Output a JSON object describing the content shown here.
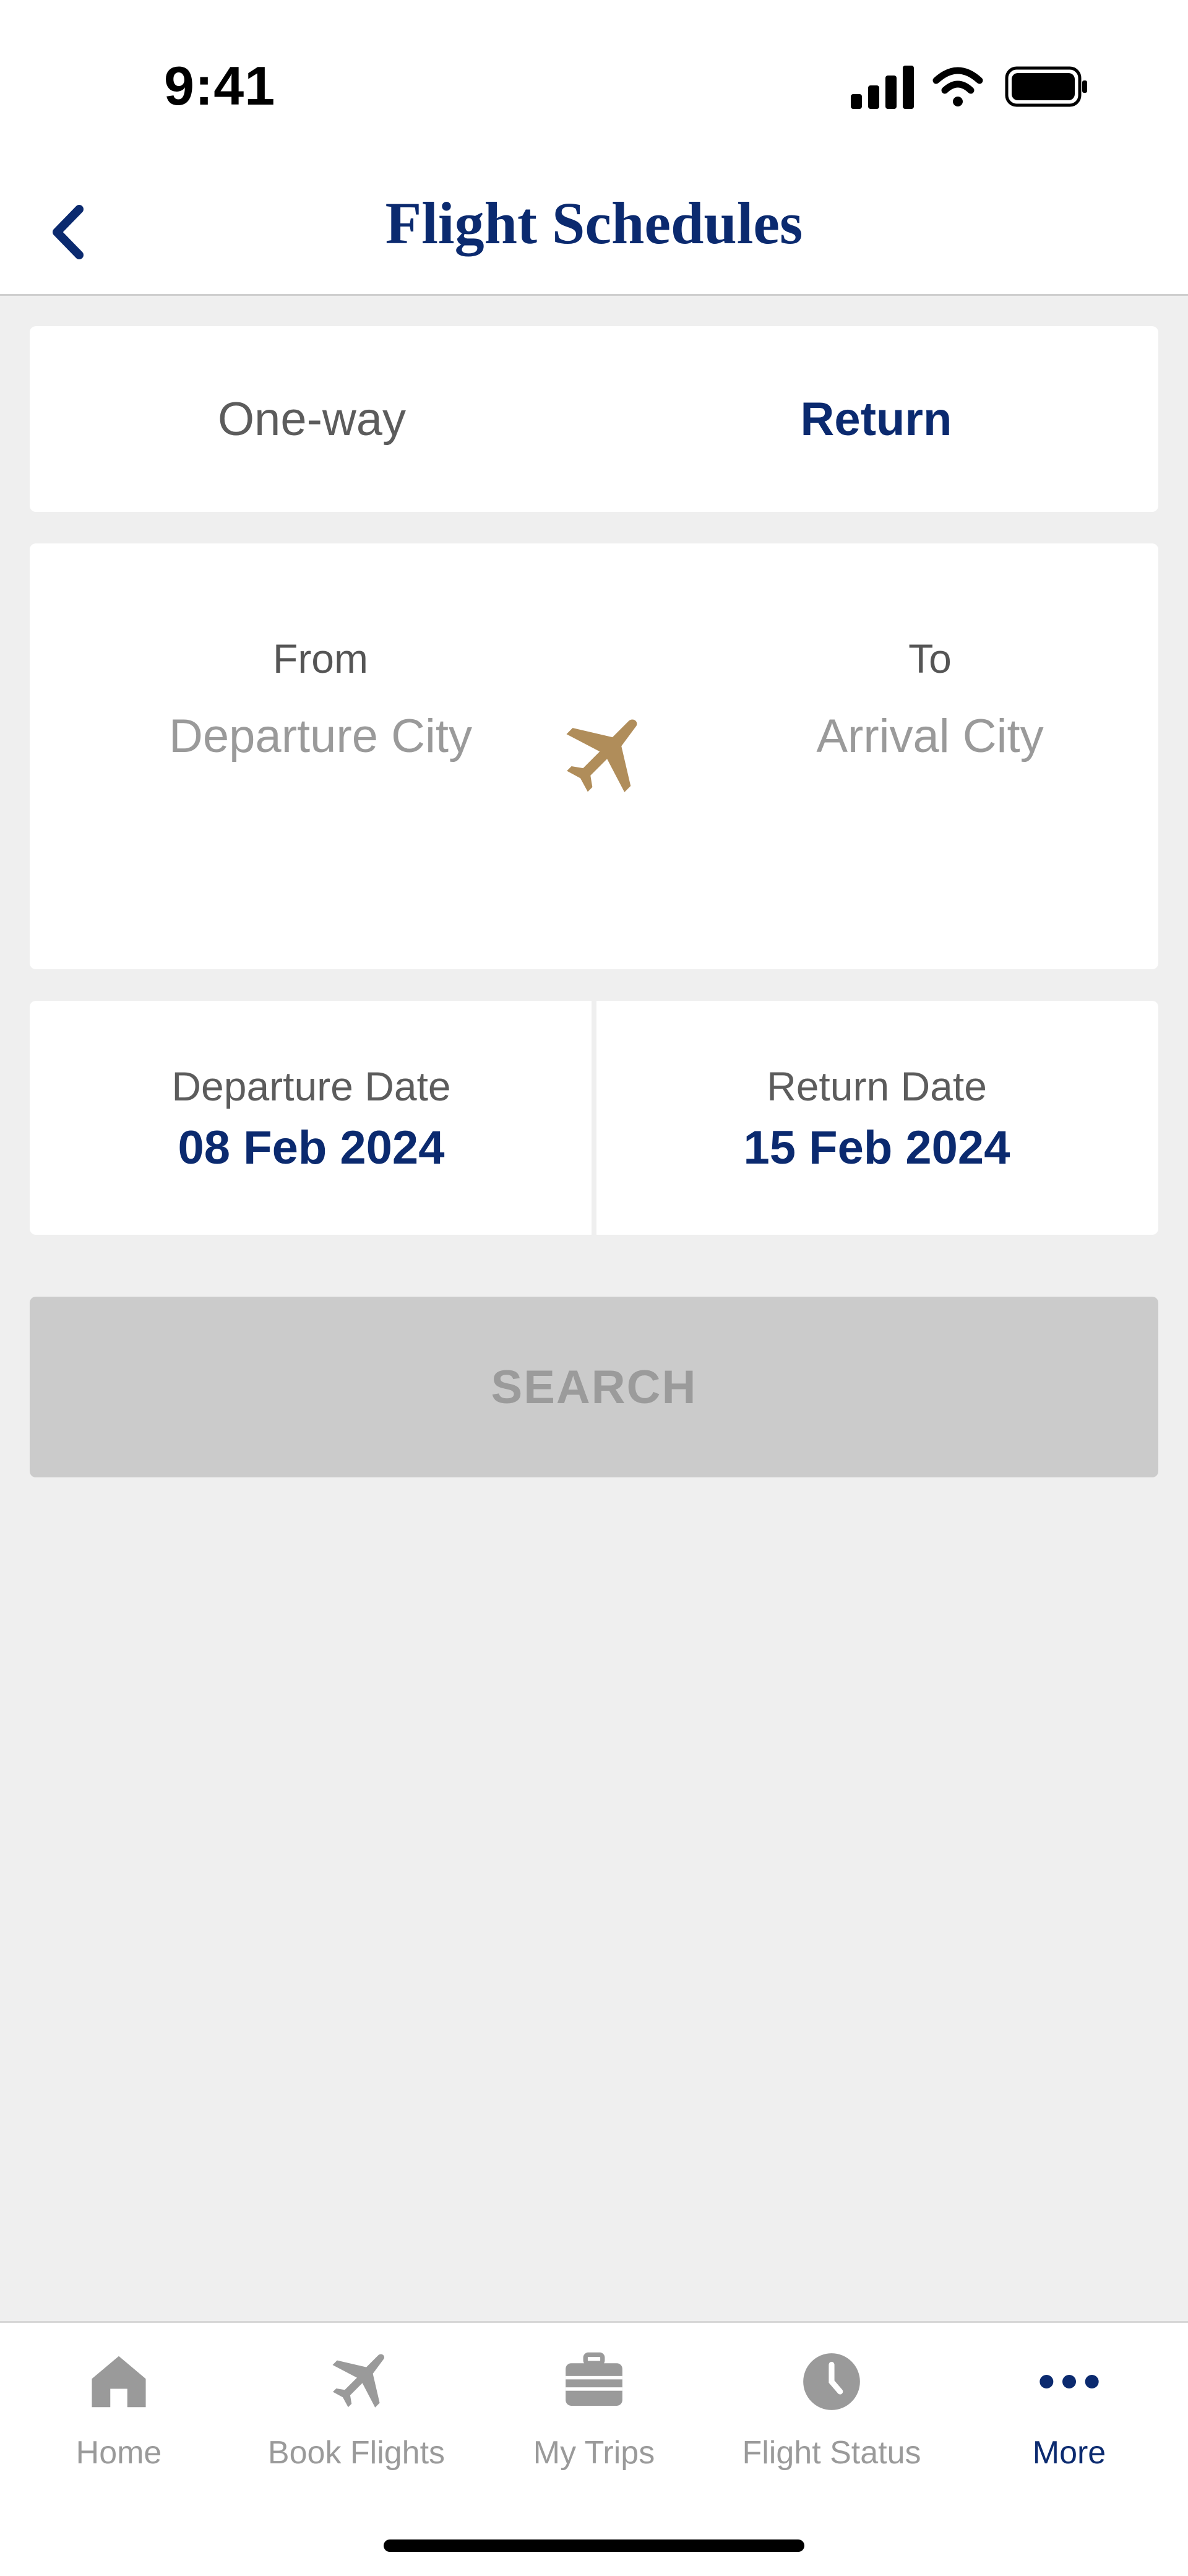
{
  "status_bar": {
    "time": "9:41"
  },
  "nav": {
    "title": "Flight Schedules"
  },
  "trip_type": {
    "options": [
      "One-way",
      "Return"
    ],
    "selected": "Return"
  },
  "route": {
    "from_label": "From",
    "from_value": "Departure City",
    "to_label": "To",
    "to_value": "Arrival City",
    "swap_icon": "airplane-icon"
  },
  "dates": {
    "departure_label": "Departure Date",
    "departure_value": "08 Feb 2024",
    "return_label": "Return Date",
    "return_value": "15 Feb 2024"
  },
  "search": {
    "label": "SEARCH"
  },
  "tab_bar": {
    "items": [
      {
        "label": "Home",
        "icon": "home-icon"
      },
      {
        "label": "Book Flights",
        "icon": "airplane-icon"
      },
      {
        "label": "My Trips",
        "icon": "suitcase-icon"
      },
      {
        "label": "Flight Status",
        "icon": "clock-icon"
      },
      {
        "label": "More",
        "icon": "more-dots-icon"
      }
    ],
    "active": "More"
  },
  "colors": {
    "brand_navy": "#0b2a6f",
    "accent_gold": "#b08d5a",
    "background": "#efefef",
    "disabled_button": "#cbcbcb"
  }
}
